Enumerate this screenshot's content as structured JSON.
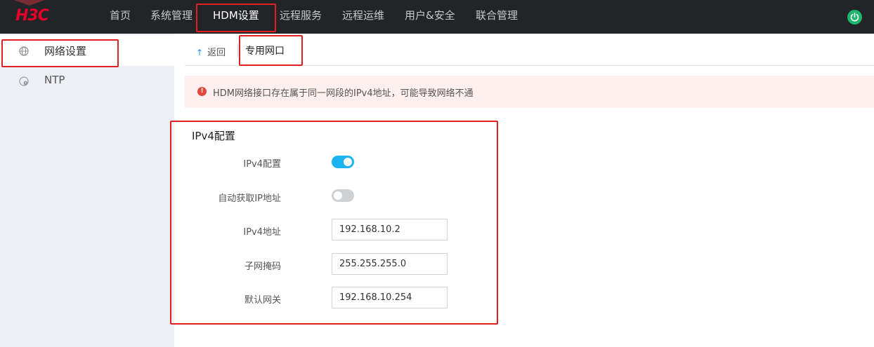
{
  "brand": {
    "logo_text": "H3C"
  },
  "nav": {
    "items": [
      {
        "label": "首页"
      },
      {
        "label": "系统管理"
      },
      {
        "label": "HDM设置"
      },
      {
        "label": "远程服务"
      },
      {
        "label": "远程运维"
      },
      {
        "label": "用户&安全"
      },
      {
        "label": "联合管理"
      }
    ],
    "active": "HDM设置",
    "power_icon": "power-icon",
    "power_color": "#1db46b"
  },
  "sidebar": {
    "items": [
      {
        "label": "网络设置",
        "icon": "globe-icon",
        "active": true
      },
      {
        "label": "NTP",
        "icon": "clock-globe-icon",
        "active": false
      }
    ]
  },
  "tabs": {
    "back_label": "返回",
    "active_tab": "专用网口"
  },
  "alert": {
    "icon": "info-icon",
    "text": "HDM网络接口存在属于同一网段的IPv4地址，可能导致网络不通"
  },
  "ipv4": {
    "section_title": "IPv4配置",
    "fields": {
      "ipv4_enable": {
        "label": "IPv4配置",
        "value": true
      },
      "dhcp": {
        "label": "自动获取IP地址",
        "value": false
      },
      "address": {
        "label": "IPv4地址",
        "value": "192.168.10.2"
      },
      "netmask": {
        "label": "子网掩码",
        "value": "255.255.255.0"
      },
      "gateway": {
        "label": "默认网关",
        "value": "192.168.10.254"
      }
    }
  },
  "colors": {
    "accent": "#1bb4f1",
    "annotation": "#e02020",
    "topbar": "#222428",
    "sidebar": "#eeeff5",
    "alert_bg": "#fdf0ef"
  }
}
